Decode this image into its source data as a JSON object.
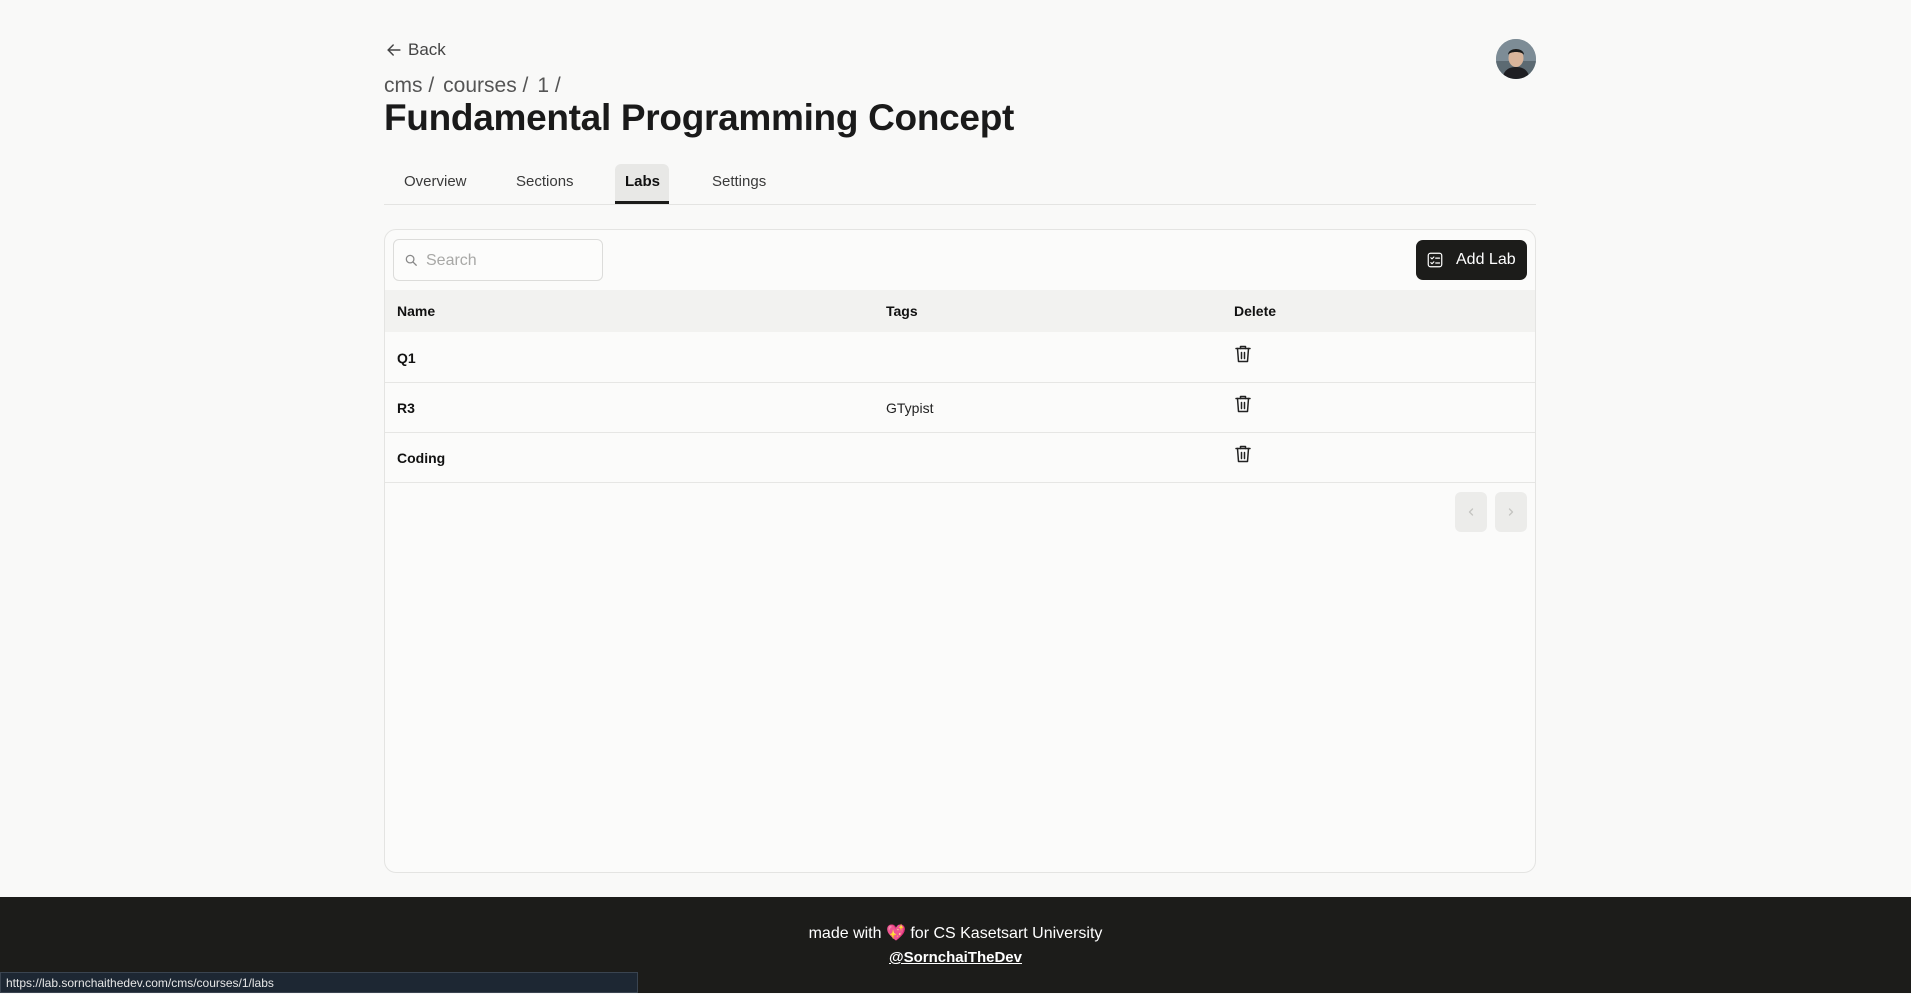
{
  "header": {
    "back_label": "Back",
    "breadcrumb": [
      "cms /",
      "courses /",
      "1 /"
    ],
    "title": "Fundamental Programming Concept"
  },
  "tabs": [
    {
      "label": "Overview",
      "active": false
    },
    {
      "label": "Sections",
      "active": false
    },
    {
      "label": "Labs",
      "active": true
    },
    {
      "label": "Settings",
      "active": false
    }
  ],
  "toolbar": {
    "search_placeholder": "Search",
    "search_value": "",
    "add_label": "Add Lab"
  },
  "table": {
    "columns": [
      "Name",
      "Tags",
      "Delete"
    ],
    "rows": [
      {
        "name": "Q1",
        "tags": ""
      },
      {
        "name": "R3",
        "tags": "GTypist"
      },
      {
        "name": "Coding",
        "tags": ""
      }
    ]
  },
  "footer": {
    "made_with": "made with",
    "heart": "💖",
    "for_text": "for CS Kasetsart University",
    "handle": "@SornchaiTheDev"
  },
  "status_url": "https://lab.sornchaithedev.com/cms/courses/1/labs",
  "icons": {
    "back": "arrow-left-icon",
    "search": "search-icon",
    "add": "checklist-icon",
    "delete": "trash-icon",
    "prev": "chevron-left-icon",
    "next": "chevron-right-icon"
  }
}
